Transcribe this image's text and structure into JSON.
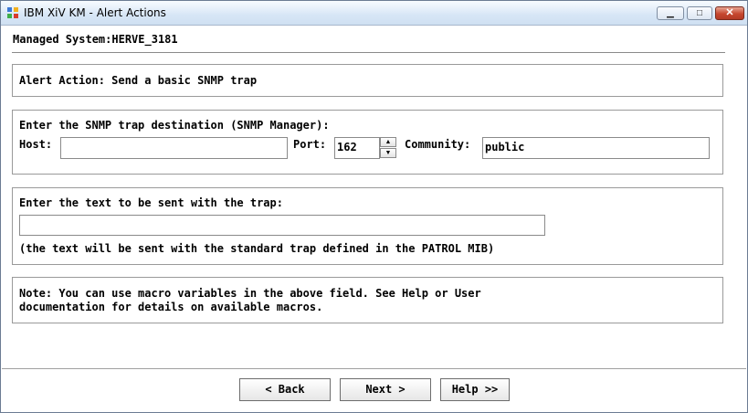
{
  "window": {
    "title": "IBM XiV KM - Alert Actions",
    "controls": {
      "minimize": "▁",
      "maximize": "□",
      "close": "✕"
    }
  },
  "managed_system": "Managed System:HERVE_3181",
  "alert_action": "Alert Action: Send a basic SNMP trap",
  "destination": {
    "heading": "Enter the SNMP trap destination (SNMP Manager):",
    "host_label": "Host:",
    "host_value": "",
    "port_label": "Port:",
    "port_value": "162",
    "community_label": "Community:",
    "community_value": "public"
  },
  "trap_text": {
    "heading": "Enter the text to be sent with the trap:",
    "value": "",
    "note": "(the text will be sent with the standard trap defined in the PATROL MIB)"
  },
  "macro_note": {
    "line1": "Note: You can use macro variables in the above field. See Help or User",
    "line2": "documentation for details on available macros."
  },
  "buttons": {
    "back": "< Back",
    "next": "Next >",
    "help": "Help >>"
  }
}
